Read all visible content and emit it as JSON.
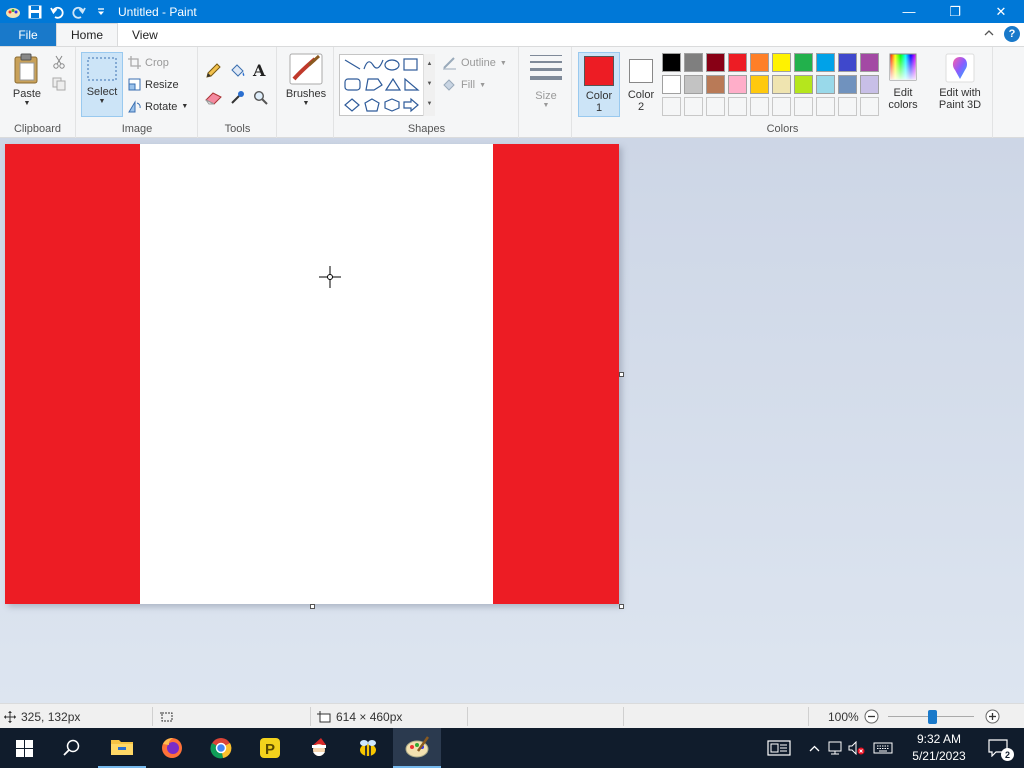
{
  "window": {
    "title": "Untitled - Paint",
    "buttons": {
      "minimize": "—",
      "maximize": "❐",
      "close": "✕"
    }
  },
  "tabs": [
    {
      "label": "File"
    },
    {
      "label": "Home"
    },
    {
      "label": "View"
    }
  ],
  "ribbon": {
    "clipboard": {
      "group_label": "Clipboard",
      "paste_label": "Paste"
    },
    "image": {
      "group_label": "Image",
      "select_label": "Select",
      "crop_label": "Crop",
      "resize_label": "Resize",
      "rotate_label": "Rotate"
    },
    "tools": {
      "group_label": "Tools"
    },
    "brushes": {
      "label": "Brushes"
    },
    "shapes": {
      "group_label": "Shapes",
      "outline_label": "Outline",
      "fill_label": "Fill"
    },
    "size": {
      "label": "Size"
    },
    "colors": {
      "group_label": "Colors",
      "color1_label": "Color",
      "color1_num": "1",
      "color2_label": "Color",
      "color2_num": "2",
      "color1_value": "#ed1c24",
      "color2_value": "#ffffff",
      "edit_colors_line1": "Edit",
      "edit_colors_line2": "colors",
      "paint3d_line1": "Edit with",
      "paint3d_line2": "Paint 3D",
      "palette_row1": [
        "#000000",
        "#7f7f7f",
        "#880015",
        "#ed1c24",
        "#ff7f27",
        "#fff200",
        "#22b14c",
        "#00a2e8",
        "#3f48cc",
        "#a349a4"
      ],
      "palette_row2": [
        "#ffffff",
        "#c3c3c3",
        "#b97a57",
        "#ffaec9",
        "#ffc90e",
        "#efe4b0",
        "#b5e61d",
        "#99d9ea",
        "#7092be",
        "#c8bfe7"
      ]
    }
  },
  "canvas": {
    "band_color": "#ed1c24",
    "middle_color": "#ffffff"
  },
  "status": {
    "cursor_pos": "325, 132px",
    "selection_size": "",
    "image_size": "614 × 460px",
    "zoom": "100%",
    "zoom_fraction": 0.5
  },
  "taskbar": {
    "time": "9:32 AM",
    "date": "5/21/2023",
    "notification_count": "2"
  }
}
